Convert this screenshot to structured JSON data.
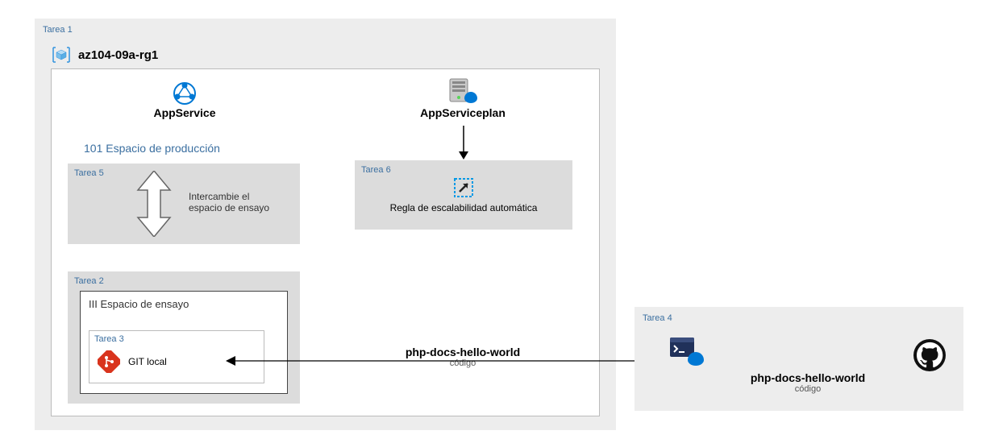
{
  "tarea1": {
    "label": "Tarea 1"
  },
  "rg": {
    "name": "az104-09a-rg1"
  },
  "appservice": {
    "label": "AppService"
  },
  "prod": {
    "label": "101 Espacio de producción"
  },
  "appserviceplan": {
    "label": "AppServiceplan"
  },
  "tarea5": {
    "label": "Tarea 5",
    "swap1": "Intercambie el",
    "swap2": "espacio de ensayo"
  },
  "tarea6": {
    "label": "Tarea 6",
    "rule": "Regla de escalabilidad automática"
  },
  "tarea2": {
    "label": "Tarea 2",
    "staging": "III Espacio de ensayo"
  },
  "tarea3": {
    "label": "Tarea 3",
    "git": "GIT local"
  },
  "code1": {
    "name": "php-docs-hello-world",
    "sub": "código"
  },
  "tarea4": {
    "label": "Tarea 4"
  },
  "code2": {
    "name": "php-docs-hello-world",
    "sub": "código"
  }
}
